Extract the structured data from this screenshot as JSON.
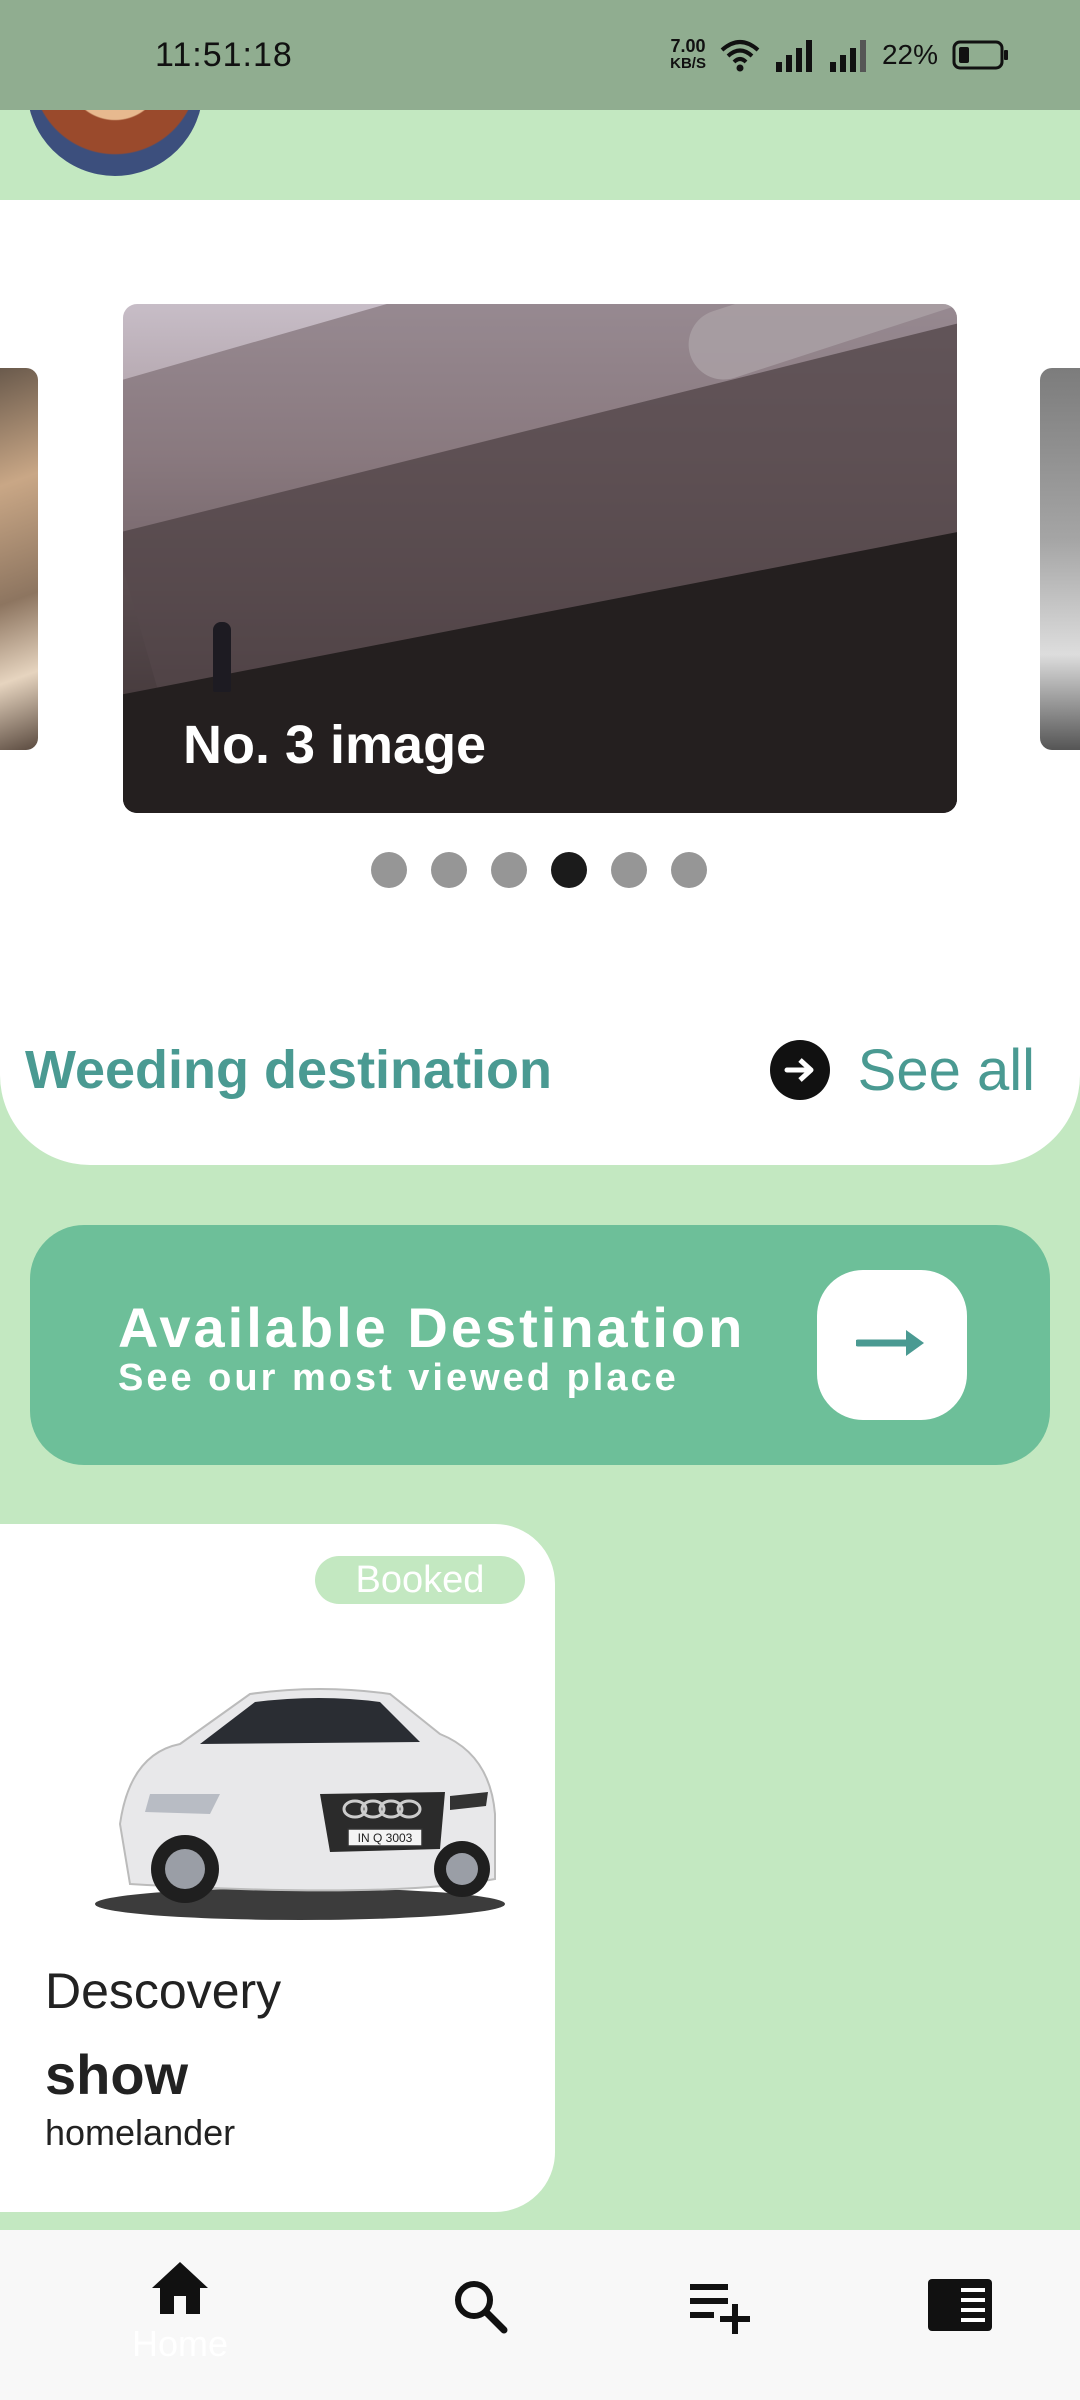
{
  "status_bar": {
    "time": "11:51:18",
    "net_speed_value": "7.00",
    "net_speed_unit": "KB/S",
    "battery": "22%"
  },
  "carousel": {
    "caption": "No. 3 image",
    "dot_count": 6,
    "active_index": 3
  },
  "section": {
    "title": "Weeding destination",
    "see_all": "See all"
  },
  "banner": {
    "title": "Available Destination",
    "subtitle": "See our most viewed place"
  },
  "card": {
    "badge": "Booked",
    "name": "Descovery",
    "subtitle": "show",
    "owner": "homelander",
    "car_plate": "IN Q 3003"
  },
  "bottom_nav": {
    "home_label": "Home",
    "icons": [
      "home-icon",
      "search-icon",
      "playlist-add-icon",
      "article-icon"
    ]
  },
  "colors": {
    "background": "#c3e8c1",
    "accent": "#4a9a92",
    "banner": "#6dbf99",
    "status_bar": "#90ad90"
  }
}
